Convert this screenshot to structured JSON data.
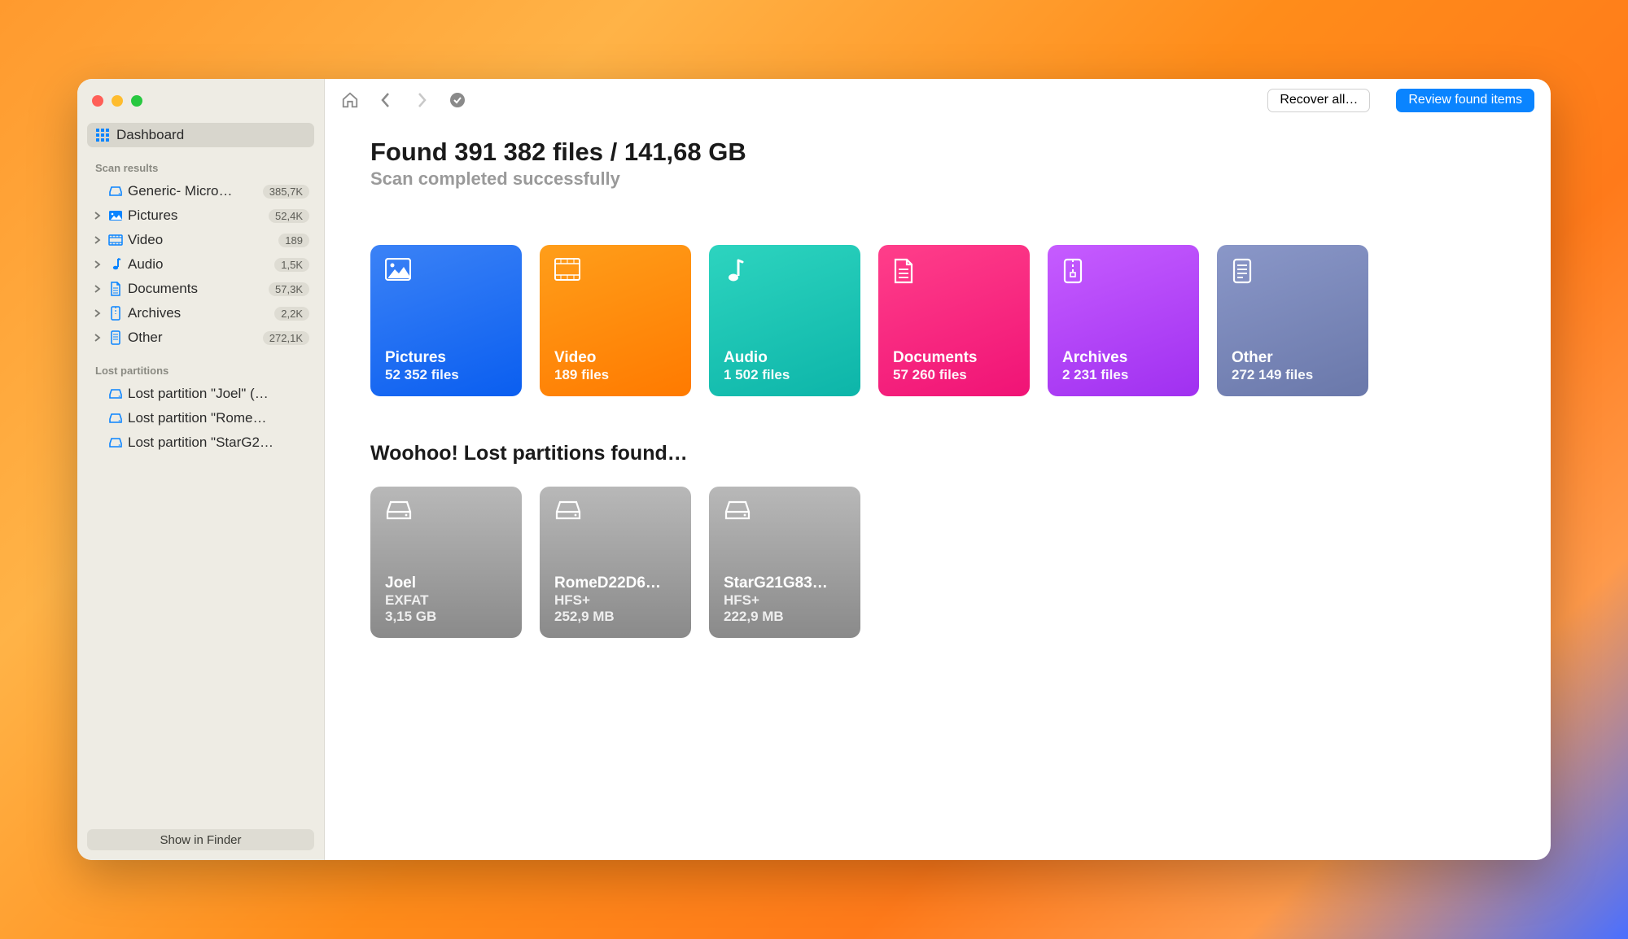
{
  "sidebar": {
    "dashboard_label": "Dashboard",
    "scan_results_header": "Scan results",
    "disk": {
      "label": "Generic- Micro…",
      "badge": "385,7K"
    },
    "categories": [
      {
        "label": "Pictures",
        "badge": "52,4K"
      },
      {
        "label": "Video",
        "badge": "189"
      },
      {
        "label": "Audio",
        "badge": "1,5K"
      },
      {
        "label": "Documents",
        "badge": "57,3K"
      },
      {
        "label": "Archives",
        "badge": "2,2K"
      },
      {
        "label": "Other",
        "badge": "272,1K"
      }
    ],
    "lost_partitions_header": "Lost partitions",
    "partitions": [
      {
        "label": "Lost partition \"Joel\" (…"
      },
      {
        "label": "Lost partition \"Rome…"
      },
      {
        "label": "Lost partition \"StarG2…"
      }
    ],
    "footer_label": "Show in Finder"
  },
  "toolbar": {
    "recover_label": "Recover all…",
    "review_label": "Review found items"
  },
  "main": {
    "title": "Found 391 382 files / 141,68 GB",
    "subtitle": "Scan completed successfully",
    "tiles": [
      {
        "label": "Pictures",
        "count": "52 352 files",
        "gradient": [
          "#3b82f6",
          "#0a5ef0"
        ]
      },
      {
        "label": "Video",
        "count": "189 files",
        "gradient": [
          "#ff9e1a",
          "#ff7a00"
        ]
      },
      {
        "label": "Audio",
        "count": "1 502 files",
        "gradient": [
          "#2dd4bf",
          "#0db5a9"
        ]
      },
      {
        "label": "Documents",
        "count": "57 260 files",
        "gradient": [
          "#ff3e8a",
          "#f01376"
        ]
      },
      {
        "label": "Archives",
        "count": "2 231 files",
        "gradient": [
          "#c65cff",
          "#a030f0"
        ]
      },
      {
        "label": "Other",
        "count": "272 149 files",
        "gradient": [
          "#8a97c8",
          "#6a78aa"
        ]
      }
    ],
    "partitions_title": "Woohoo! Lost partitions found…",
    "partition_tiles": [
      {
        "name": "Joel",
        "fs": "EXFAT",
        "size": "3,15 GB"
      },
      {
        "name": "RomeD22D6…",
        "fs": "HFS+",
        "size": "252,9 MB"
      },
      {
        "name": "StarG21G83…",
        "fs": "HFS+",
        "size": "222,9 MB"
      }
    ]
  }
}
